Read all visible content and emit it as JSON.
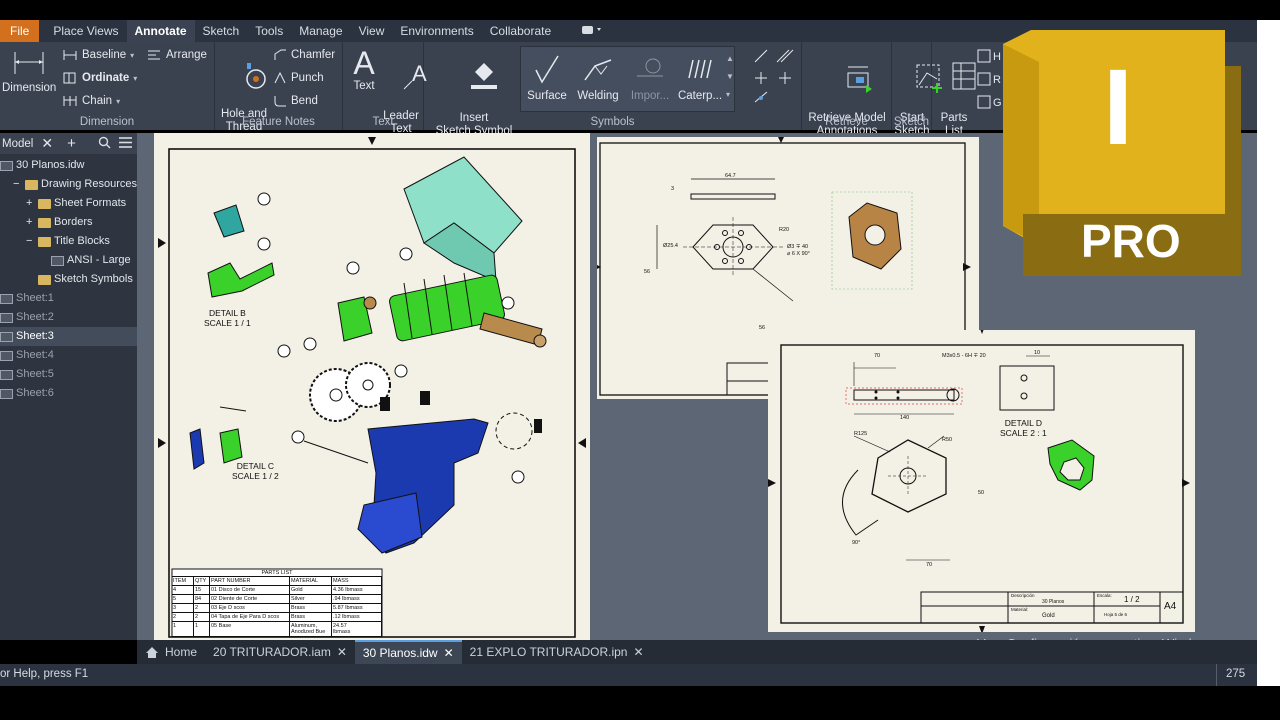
{
  "menu": {
    "file": "File",
    "items": [
      "Place Views",
      "Annotate",
      "Sketch",
      "Tools",
      "Manage",
      "View",
      "Environments",
      "Collaborate"
    ]
  },
  "ribbon": {
    "dimension": {
      "big_label": "Dimension",
      "baseline": "Baseline",
      "ordinate": "Ordinate",
      "chain": "Chain",
      "arrange": "Arrange",
      "group": "Dimension"
    },
    "feature_notes": {
      "hole_thread": "Hole and\nThread",
      "chamfer": "Chamfer",
      "punch": "Punch",
      "bend": "Bend",
      "group": "Feature Notes"
    },
    "text": {
      "text": "Text",
      "leader_text": "Leader\nText",
      "group": "Text"
    },
    "symbols": {
      "insert_sketch_symbol": "Insert\nSketch Symbol",
      "surface": "Surface",
      "welding": "Welding",
      "import": "Impor...",
      "caterpillar": "Caterp...",
      "group": "Symbols"
    },
    "retrieve": {
      "retrieve_model": "Retrieve Model\nAnnotations",
      "group": "Retrieve"
    },
    "sketch": {
      "start_sketch": "Start\nSketch",
      "group": "Sketch"
    },
    "parts_list": "Parts\nList"
  },
  "browser": {
    "title": "Model",
    "items": [
      {
        "label": "30 Planos.idw",
        "indent": 0,
        "kind": "doc"
      },
      {
        "label": "Drawing Resources",
        "indent": 1,
        "kind": "folder",
        "exp": "−"
      },
      {
        "label": "Sheet Formats",
        "indent": 2,
        "kind": "folder",
        "exp": "+"
      },
      {
        "label": "Borders",
        "indent": 2,
        "kind": "folder",
        "exp": "+"
      },
      {
        "label": "Title Blocks",
        "indent": 2,
        "kind": "folder",
        "exp": "−"
      },
      {
        "label": "ANSI - Large",
        "indent": 3,
        "kind": "sheet"
      },
      {
        "label": "Sketch Symbols",
        "indent": 2,
        "kind": "folder"
      },
      {
        "label": "Sheet:1",
        "indent": 0,
        "kind": "sheet",
        "dim": true
      },
      {
        "label": "Sheet:2",
        "indent": 0,
        "kind": "sheet",
        "dim": true
      },
      {
        "label": "Sheet:3",
        "indent": 0,
        "kind": "sheet",
        "selected": true
      },
      {
        "label": "Sheet:4",
        "indent": 0,
        "kind": "sheet",
        "dim": true
      },
      {
        "label": "Sheet:5",
        "indent": 0,
        "kind": "sheet",
        "dim": true
      },
      {
        "label": "Sheet:6",
        "indent": 0,
        "kind": "sheet",
        "dim": true
      }
    ]
  },
  "sheet1": {
    "detail_b": "DETAIL B\nSCALE 1 / 1",
    "detail_c": "DETAIL C\nSCALE 1 / 2",
    "parts_list": {
      "title": "PARTS LIST",
      "headers": [
        "ITEM",
        "QTY",
        "PART NUMBER",
        "MATERIAL",
        "MASS"
      ],
      "rows": [
        [
          "4",
          "15",
          "01 Disco de Corte",
          "Gold",
          "4.36 lbmass"
        ],
        [
          "5",
          "84",
          "02 Diente de Corte",
          "Silver",
          ".94 lbmass"
        ],
        [
          "3",
          "2",
          "03 Eje D scos",
          "Brass",
          "5.87 lbmass"
        ],
        [
          "2",
          "2",
          "04 Tapa de Eje Para D scos",
          "Brass",
          ".12 lbmass"
        ],
        [
          "1",
          "1",
          "05 Base",
          "Aluminum,\nAnodized Bue",
          "24.57\nlbmass"
        ]
      ]
    }
  },
  "sheet2": {
    "dim_top": "64.7",
    "dim_a": "Ø25.4",
    "dim_r": "R20",
    "dim_hole": "Ø3 ∓ 40\n⌀ 6 X 90°",
    "dim_56a": "56",
    "dim_56b": "56",
    "dim_3": "3"
  },
  "sheet3": {
    "dim_70a": "70",
    "dim_thread": "M3x0.5 - 6H ∓ 20",
    "dim_10": "10",
    "dim_140": "140",
    "dim_r125": "R125",
    "dim_r50": "R50",
    "dim_50": "50",
    "dim_90": "90°",
    "dim_70b": "70",
    "detail_d": "DETAIL D\nSCALE 2 : 1",
    "tb_desc_label": "Descripción",
    "tb_desc": "30 Planos",
    "tb_mat_label": "Material:",
    "tb_mat": "Gold",
    "tb_scale_label": "Escala:",
    "tb_scale": "1 / 2",
    "tb_sheet": "Hoja 5 de 6",
    "tb_size": "A4"
  },
  "tabs": [
    {
      "label": "Home",
      "home": true
    },
    {
      "label": "20 TRITURADOR.iam"
    },
    {
      "label": "30 Planos.idw",
      "active": true
    },
    {
      "label": "21 EXPLO TRITURADOR.ipn"
    }
  ],
  "activate_windows": "Ve a Configuración para activar Windows.",
  "status": {
    "help": "or Help, press F1",
    "count": "275"
  },
  "logo": {
    "letter": "I",
    "text": "PRO"
  },
  "colors": {
    "accent": "#d2701e",
    "logo_gold": "#e2b21c",
    "logo_dark": "#8a6d12",
    "green_part": "#3bd12b",
    "blue_part": "#1c3ab0"
  }
}
